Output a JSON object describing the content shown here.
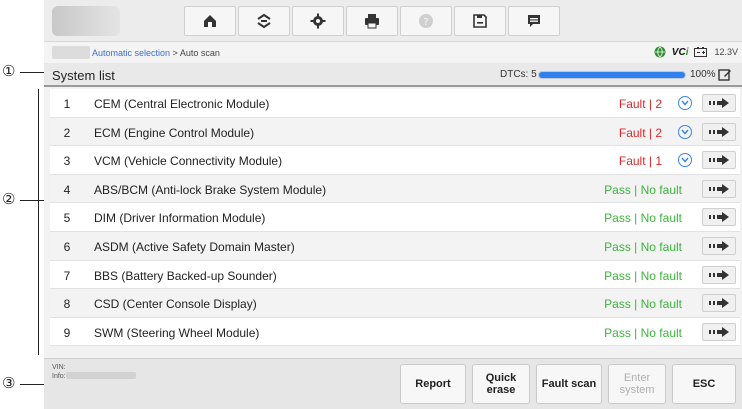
{
  "callouts": [
    "①",
    "②",
    "③"
  ],
  "toolbar": {
    "buttons": [
      {
        "name": "home-icon"
      },
      {
        "name": "vehicle-swap-icon"
      },
      {
        "name": "gear-icon"
      },
      {
        "name": "printer-icon"
      },
      {
        "name": "help-icon"
      },
      {
        "name": "save-icon"
      },
      {
        "name": "chat-icon"
      }
    ]
  },
  "breadcrumb": {
    "link": "Automatic selection",
    "separator": " > ",
    "current": "Auto scan"
  },
  "status": {
    "vci_prefix": "VC",
    "vci_suffix": "i",
    "battery": "12.3V"
  },
  "list": {
    "title": "System list",
    "dtcs_label": "DTCs: 5",
    "progress_value": 1.0,
    "progress_text": "100%"
  },
  "rows": [
    {
      "num": "1",
      "name": "CEM (Central Electronic Module)",
      "status": "Fault | 2",
      "type": "fault"
    },
    {
      "num": "2",
      "name": "ECM (Engine Control Module)",
      "status": "Fault | 2",
      "type": "fault"
    },
    {
      "num": "3",
      "name": "VCM (Vehicle Connectivity Module)",
      "status": "Fault | 1",
      "type": "fault"
    },
    {
      "num": "4",
      "name": "ABS/BCM (Anti-lock Brake System Module)",
      "status": "Pass | No fault",
      "type": "pass"
    },
    {
      "num": "5",
      "name": "DIM (Driver Information Module)",
      "status": "Pass | No fault",
      "type": "pass"
    },
    {
      "num": "6",
      "name": "ASDM (Active Safety Domain Master)",
      "status": "Pass | No fault",
      "type": "pass"
    },
    {
      "num": "7",
      "name": "BBS (Battery Backed-up Sounder)",
      "status": "Pass | No fault",
      "type": "pass"
    },
    {
      "num": "8",
      "name": "CSD (Center Console Display)",
      "status": "Pass | No fault",
      "type": "pass"
    },
    {
      "num": "9",
      "name": "SWM (Steering Wheel Module)",
      "status": "Pass | No fault",
      "type": "pass"
    }
  ],
  "footer": {
    "vin_label": "VIN: ",
    "info_label": "Info:",
    "report": "Report",
    "quick_erase_1": "Quick",
    "quick_erase_2": "erase",
    "fault_scan": "Fault scan",
    "enter_system_1": "Enter",
    "enter_system_2": "system",
    "esc": "ESC"
  },
  "colors": {
    "fault": "#e0282d",
    "pass": "#3cb43c",
    "accent": "#2f80ed"
  }
}
